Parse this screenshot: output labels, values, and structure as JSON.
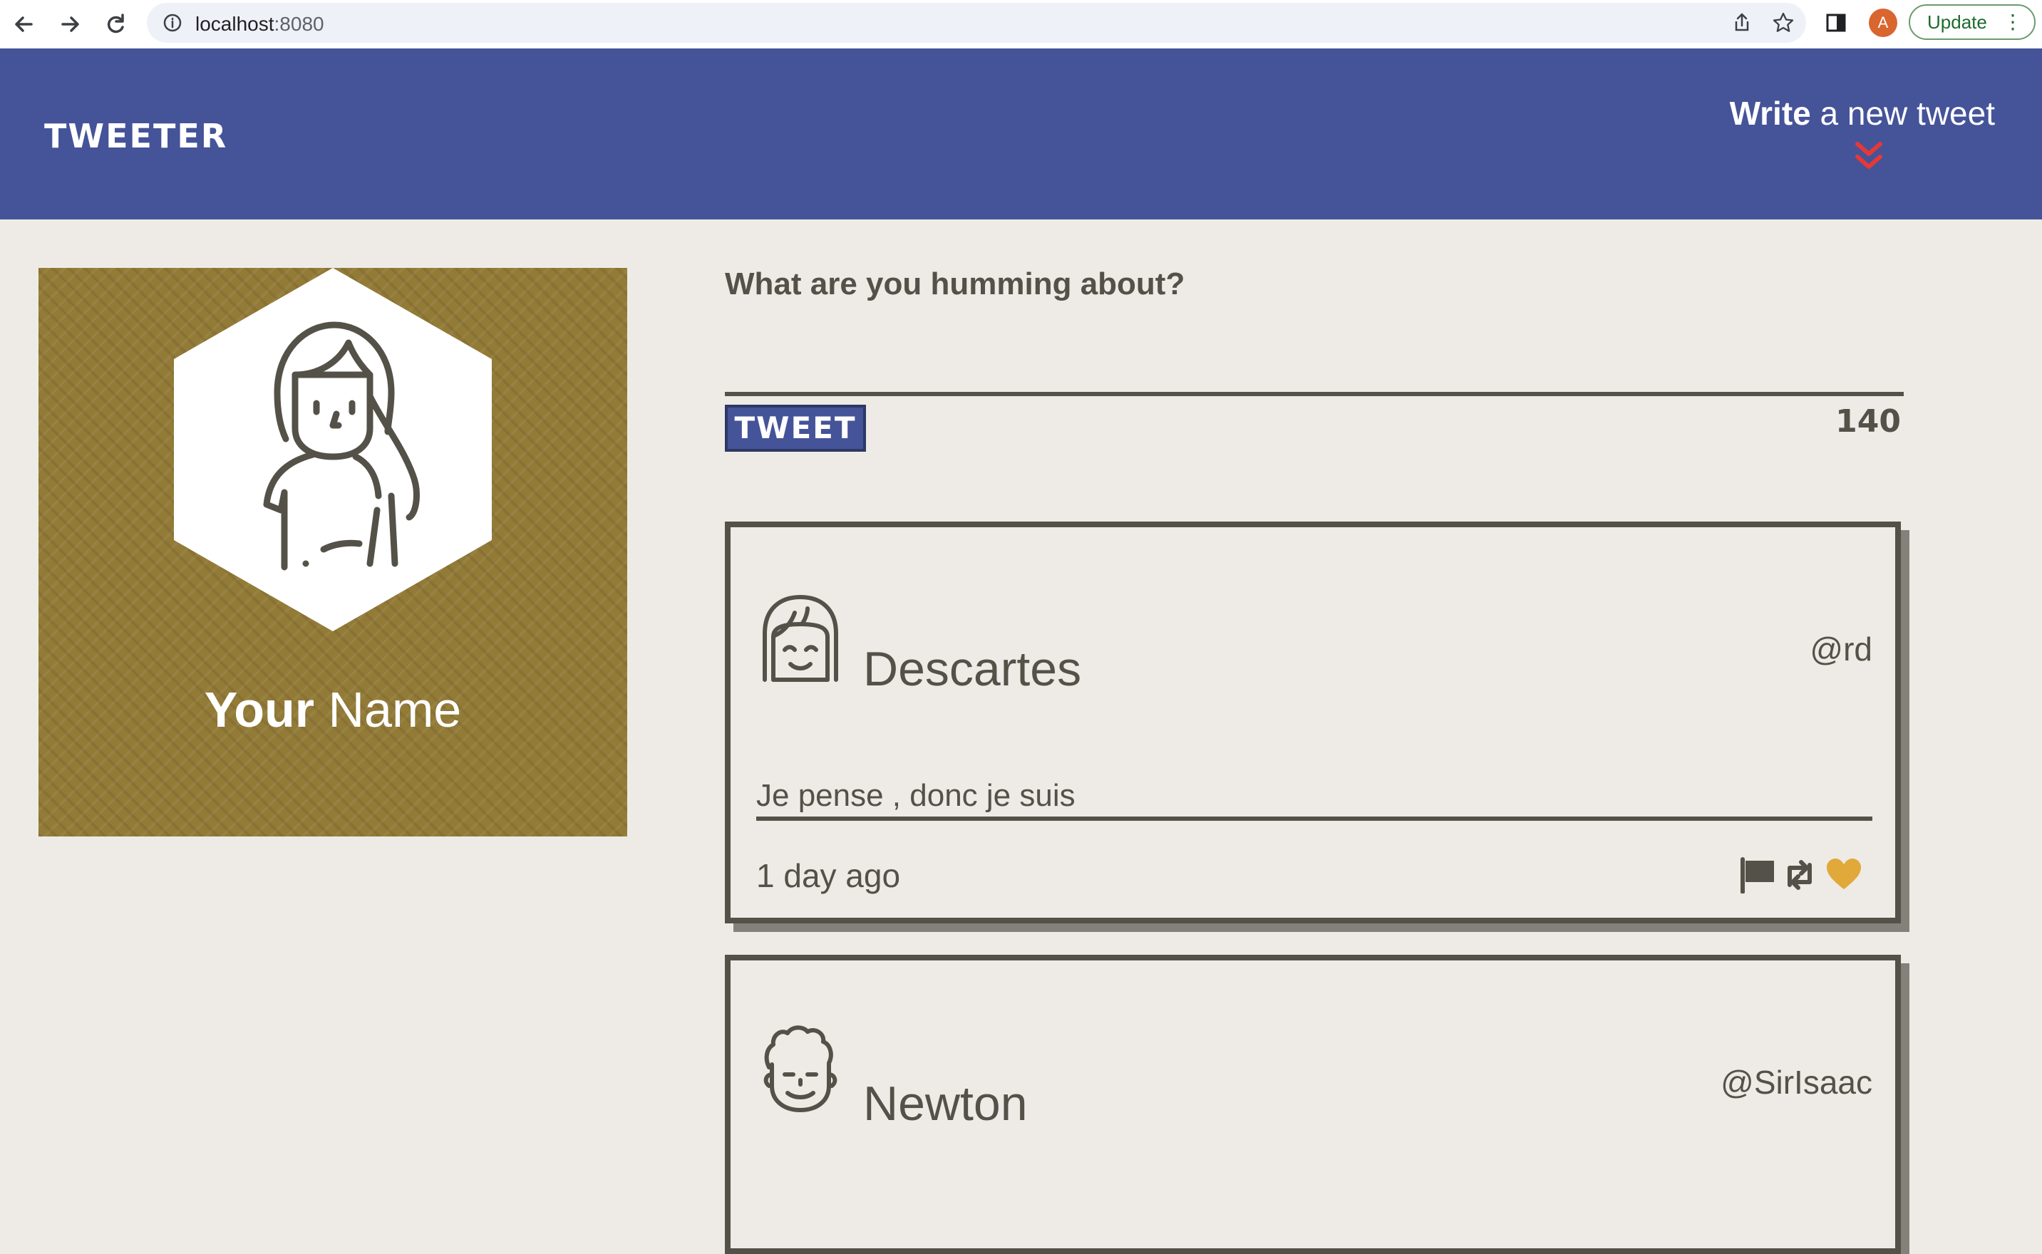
{
  "browser": {
    "url_host": "localhost",
    "url_port": ":8080",
    "profile_initial": "A",
    "update_label": "Update"
  },
  "header": {
    "logo": "TWEETER",
    "compose_toggle_bold": "Write",
    "compose_toggle_rest": " a new tweet",
    "accent_color": "#e53935"
  },
  "profile": {
    "name_bold": "Your",
    "name_rest": " Name",
    "card_color": "#927a37"
  },
  "compose": {
    "title": "What are you humming about?",
    "input_value": "",
    "submit_label": "TWEET",
    "char_count": "140"
  },
  "tweets": [
    {
      "avatar": "girl-face-icon",
      "name": "Descartes",
      "handle": "@rd",
      "content": "Je pense , donc je suis",
      "time": "1 day ago",
      "actions": [
        "flag-icon",
        "retweet-icon",
        "heart-icon"
      ]
    },
    {
      "avatar": "curly-hair-face-icon",
      "name": "Newton",
      "handle": "@SirIsaac"
    }
  ],
  "colors": {
    "header_bg": "#455399",
    "page_bg": "#eeebe6",
    "text": "#545149",
    "heart": "#e0a93a"
  }
}
